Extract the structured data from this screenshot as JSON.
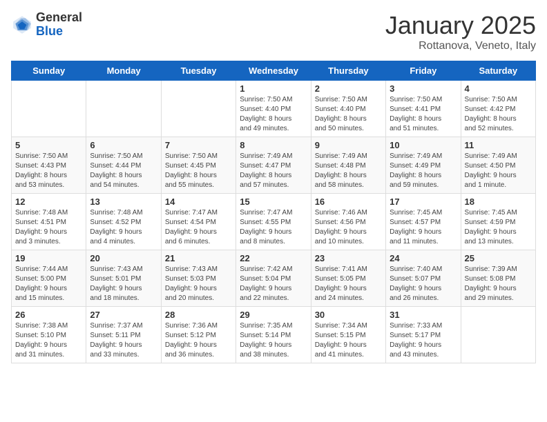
{
  "header": {
    "logo_general": "General",
    "logo_blue": "Blue",
    "title": "January 2025",
    "location": "Rottanova, Veneto, Italy"
  },
  "days_of_week": [
    "Sunday",
    "Monday",
    "Tuesday",
    "Wednesday",
    "Thursday",
    "Friday",
    "Saturday"
  ],
  "weeks": [
    [
      {
        "day": "",
        "info": ""
      },
      {
        "day": "",
        "info": ""
      },
      {
        "day": "",
        "info": ""
      },
      {
        "day": "1",
        "info": "Sunrise: 7:50 AM\nSunset: 4:40 PM\nDaylight: 8 hours\nand 49 minutes."
      },
      {
        "day": "2",
        "info": "Sunrise: 7:50 AM\nSunset: 4:40 PM\nDaylight: 8 hours\nand 50 minutes."
      },
      {
        "day": "3",
        "info": "Sunrise: 7:50 AM\nSunset: 4:41 PM\nDaylight: 8 hours\nand 51 minutes."
      },
      {
        "day": "4",
        "info": "Sunrise: 7:50 AM\nSunset: 4:42 PM\nDaylight: 8 hours\nand 52 minutes."
      }
    ],
    [
      {
        "day": "5",
        "info": "Sunrise: 7:50 AM\nSunset: 4:43 PM\nDaylight: 8 hours\nand 53 minutes."
      },
      {
        "day": "6",
        "info": "Sunrise: 7:50 AM\nSunset: 4:44 PM\nDaylight: 8 hours\nand 54 minutes."
      },
      {
        "day": "7",
        "info": "Sunrise: 7:50 AM\nSunset: 4:45 PM\nDaylight: 8 hours\nand 55 minutes."
      },
      {
        "day": "8",
        "info": "Sunrise: 7:49 AM\nSunset: 4:47 PM\nDaylight: 8 hours\nand 57 minutes."
      },
      {
        "day": "9",
        "info": "Sunrise: 7:49 AM\nSunset: 4:48 PM\nDaylight: 8 hours\nand 58 minutes."
      },
      {
        "day": "10",
        "info": "Sunrise: 7:49 AM\nSunset: 4:49 PM\nDaylight: 8 hours\nand 59 minutes."
      },
      {
        "day": "11",
        "info": "Sunrise: 7:49 AM\nSunset: 4:50 PM\nDaylight: 9 hours\nand 1 minute."
      }
    ],
    [
      {
        "day": "12",
        "info": "Sunrise: 7:48 AM\nSunset: 4:51 PM\nDaylight: 9 hours\nand 3 minutes."
      },
      {
        "day": "13",
        "info": "Sunrise: 7:48 AM\nSunset: 4:52 PM\nDaylight: 9 hours\nand 4 minutes."
      },
      {
        "day": "14",
        "info": "Sunrise: 7:47 AM\nSunset: 4:54 PM\nDaylight: 9 hours\nand 6 minutes."
      },
      {
        "day": "15",
        "info": "Sunrise: 7:47 AM\nSunset: 4:55 PM\nDaylight: 9 hours\nand 8 minutes."
      },
      {
        "day": "16",
        "info": "Sunrise: 7:46 AM\nSunset: 4:56 PM\nDaylight: 9 hours\nand 10 minutes."
      },
      {
        "day": "17",
        "info": "Sunrise: 7:45 AM\nSunset: 4:57 PM\nDaylight: 9 hours\nand 11 minutes."
      },
      {
        "day": "18",
        "info": "Sunrise: 7:45 AM\nSunset: 4:59 PM\nDaylight: 9 hours\nand 13 minutes."
      }
    ],
    [
      {
        "day": "19",
        "info": "Sunrise: 7:44 AM\nSunset: 5:00 PM\nDaylight: 9 hours\nand 15 minutes."
      },
      {
        "day": "20",
        "info": "Sunrise: 7:43 AM\nSunset: 5:01 PM\nDaylight: 9 hours\nand 18 minutes."
      },
      {
        "day": "21",
        "info": "Sunrise: 7:43 AM\nSunset: 5:03 PM\nDaylight: 9 hours\nand 20 minutes."
      },
      {
        "day": "22",
        "info": "Sunrise: 7:42 AM\nSunset: 5:04 PM\nDaylight: 9 hours\nand 22 minutes."
      },
      {
        "day": "23",
        "info": "Sunrise: 7:41 AM\nSunset: 5:05 PM\nDaylight: 9 hours\nand 24 minutes."
      },
      {
        "day": "24",
        "info": "Sunrise: 7:40 AM\nSunset: 5:07 PM\nDaylight: 9 hours\nand 26 minutes."
      },
      {
        "day": "25",
        "info": "Sunrise: 7:39 AM\nSunset: 5:08 PM\nDaylight: 9 hours\nand 29 minutes."
      }
    ],
    [
      {
        "day": "26",
        "info": "Sunrise: 7:38 AM\nSunset: 5:10 PM\nDaylight: 9 hours\nand 31 minutes."
      },
      {
        "day": "27",
        "info": "Sunrise: 7:37 AM\nSunset: 5:11 PM\nDaylight: 9 hours\nand 33 minutes."
      },
      {
        "day": "28",
        "info": "Sunrise: 7:36 AM\nSunset: 5:12 PM\nDaylight: 9 hours\nand 36 minutes."
      },
      {
        "day": "29",
        "info": "Sunrise: 7:35 AM\nSunset: 5:14 PM\nDaylight: 9 hours\nand 38 minutes."
      },
      {
        "day": "30",
        "info": "Sunrise: 7:34 AM\nSunset: 5:15 PM\nDaylight: 9 hours\nand 41 minutes."
      },
      {
        "day": "31",
        "info": "Sunrise: 7:33 AM\nSunset: 5:17 PM\nDaylight: 9 hours\nand 43 minutes."
      },
      {
        "day": "",
        "info": ""
      }
    ]
  ]
}
